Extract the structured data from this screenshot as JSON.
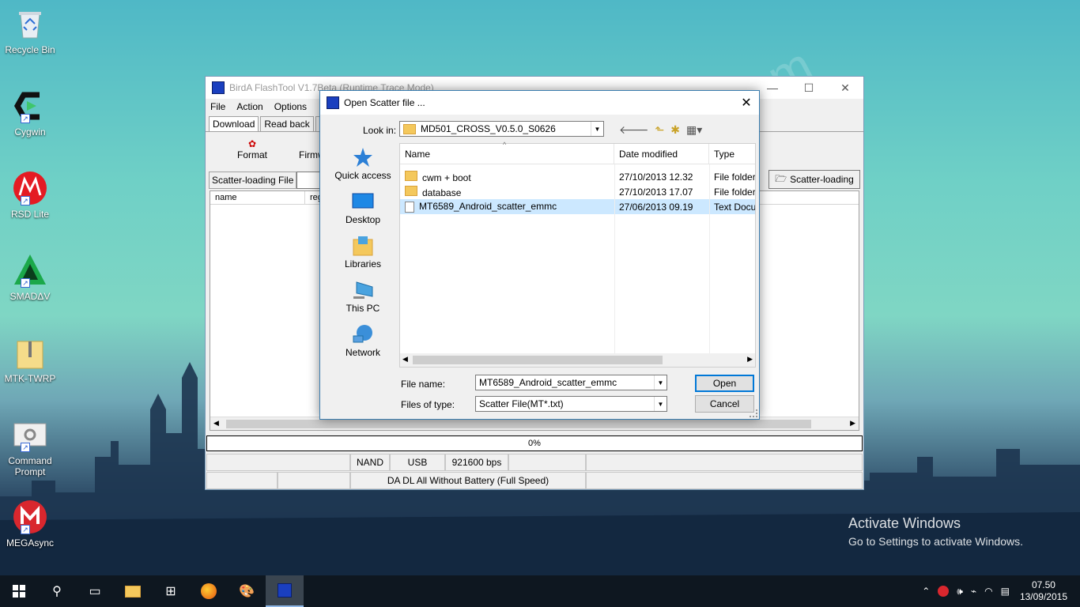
{
  "watermark": "catatandroid.blogspot.com",
  "desktop": {
    "icons": [
      {
        "label": "Recycle Bin"
      },
      {
        "label": "Cygwin"
      },
      {
        "label": "RSD Lite"
      },
      {
        "label": "SMADΔV"
      },
      {
        "label": "MTK-TWRP"
      },
      {
        "label": "Command Prompt"
      },
      {
        "label": "MEGAsync"
      }
    ]
  },
  "mainwindow": {
    "title": "BirdA FlashTool V1.7Beta (Runtime Trace Mode)",
    "menu": [
      "File",
      "Action",
      "Options"
    ],
    "tabs": [
      "Download",
      "Read back",
      "Me"
    ],
    "toolbar": {
      "format": "Format",
      "firmware": "Firmwa"
    },
    "scatter_label": "Scatter-loading File",
    "scatter_button": "Scatter-loading",
    "list_headers": [
      "name",
      "reg"
    ],
    "progress": "0%",
    "status_row1": [
      "NAND",
      "USB",
      "921600 bps"
    ],
    "status_row2": "DA DL All Without Battery (Full Speed)"
  },
  "dialog": {
    "title": "Open Scatter file ...",
    "look_in_label": "Look in:",
    "look_in_value": "MD501_CROSS_V0.5.0_S0626",
    "places": [
      "Quick access",
      "Desktop",
      "Libraries",
      "This PC",
      "Network"
    ],
    "columns": [
      "Name",
      "Date modified",
      "Type"
    ],
    "files": [
      {
        "name": "cwm + boot",
        "date": "27/10/2013 12.32",
        "type": "File folder"
      },
      {
        "name": "database",
        "date": "27/10/2013 17.07",
        "type": "File folder"
      },
      {
        "name": "MT6589_Android_scatter_emmc",
        "date": "27/06/2013 09.19",
        "type": "Text Docu"
      }
    ],
    "file_name_label": "File name:",
    "file_name_value": "MT6589_Android_scatter_emmc",
    "file_type_label": "Files of type:",
    "file_type_value": "Scatter File(MT*.txt)",
    "open_button": "Open",
    "cancel_button": "Cancel"
  },
  "activation": {
    "line1": "Activate Windows",
    "line2": "Go to Settings to activate Windows."
  },
  "taskbar": {
    "time": "07.50",
    "date": "13/09/2015"
  }
}
